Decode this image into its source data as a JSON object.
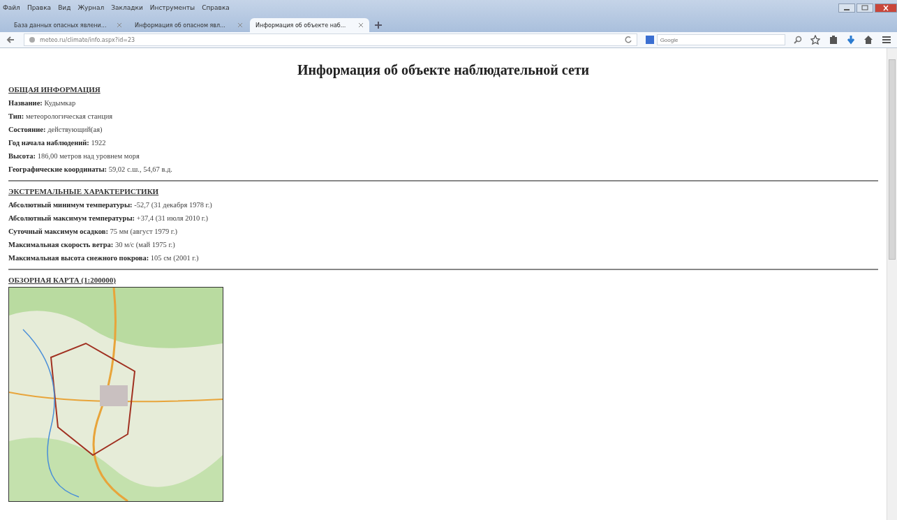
{
  "menu": [
    "Файл",
    "Правка",
    "Вид",
    "Журнал",
    "Закладки",
    "Инструменты",
    "Справка"
  ],
  "tabs": [
    {
      "label": "База данных опасных явлени...",
      "selected": false
    },
    {
      "label": "Информация об опасном явл...",
      "selected": false
    },
    {
      "label": "Информация об объекте наб...",
      "selected": true
    }
  ],
  "address_bar": {
    "url": "meteo.ru/climate/info.aspx?id=23"
  },
  "search": {
    "placeholder": "Google"
  },
  "page": {
    "title": "Информация об объекте наблюдательной сети",
    "sections": [
      {
        "heading": "ОБЩАЯ ИНФОРМАЦИЯ",
        "kind": "fields",
        "items": [
          {
            "label": "Название:",
            "value": "Кудымкар"
          },
          {
            "label": "Тип:",
            "value": "метеорологическая станция"
          },
          {
            "label": "Состояние:",
            "value": "действующий(ая)"
          },
          {
            "label": "Год начала наблюдений:",
            "value": "1922"
          },
          {
            "label": "Высота:",
            "value": "186,00 метров над уровнем моря"
          },
          {
            "label": "Географические координаты:",
            "value": "59,02 с.ш., 54,67 в.д."
          }
        ]
      },
      {
        "heading": "ЭКСТРЕМАЛЬНЫЕ ХАРАКТЕРИСТИКИ",
        "kind": "fields",
        "items": [
          {
            "label": "Абсолютный минимум температуры:",
            "value": "-52,7 (31 декабря 1978 г.)"
          },
          {
            "label": "Абсолютный максимум температуры:",
            "value": "+37,4 (31 июля 2010 г.)"
          },
          {
            "label": "Суточный максимум осадков:",
            "value": "75 мм (август 1979 г.)"
          },
          {
            "label": "Максимальная скорость ветра:",
            "value": "30 м/с (май 1975 г.)"
          },
          {
            "label": "Максимальная высота снежного покрова:",
            "value": "105 см (2001 г.)"
          }
        ]
      },
      {
        "heading": "ОБЗОРНАЯ КАРТА (1:200000)",
        "kind": "map"
      }
    ]
  }
}
